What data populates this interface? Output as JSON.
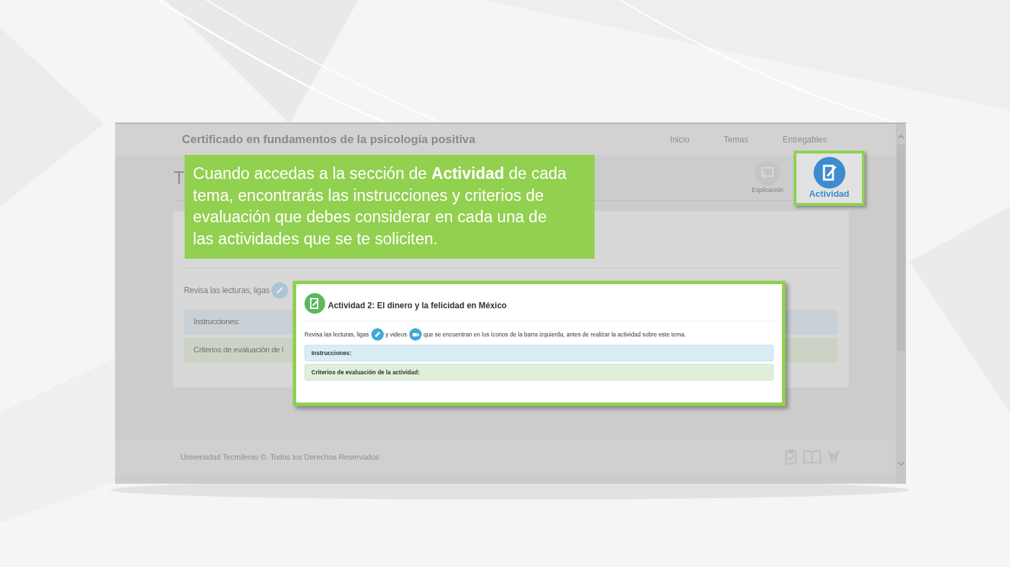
{
  "site": {
    "title": "Certificado en fundamentos de la psicología positiva",
    "nav": [
      {
        "label": "Inicio"
      },
      {
        "label": "Temas"
      },
      {
        "label": "Entregables"
      }
    ]
  },
  "section_title": "T",
  "tools": [
    {
      "label": "Explicación",
      "highlighted": false
    },
    {
      "label": "Actividad",
      "highlighted": true
    }
  ],
  "content": {
    "intro": "Revisa las lecturas, ligas",
    "panels": [
      {
        "kind": "info",
        "label": "Instrucciones:"
      },
      {
        "kind": "success",
        "label": "Criterios de evaluación de l"
      }
    ]
  },
  "footer": {
    "text": "Universidad Tecmilenio ©. Todos los Derechos Reservados"
  },
  "callout": {
    "text": "Cuando accedas a la sección de **Actividad** de cada tema, encontrarás las instrucciones y criterios de evaluación que debes considerar en cada una de las actividades que se te soliciten."
  },
  "zoom_card": {
    "title": "Actividad 2: El dinero y la felicidad en México",
    "intro": [
      {
        "kind": "text",
        "text": "Revisa las lecturas, ligas"
      },
      {
        "kind": "link"
      },
      {
        "kind": "text",
        "text": "y videos"
      },
      {
        "kind": "video"
      },
      {
        "kind": "text",
        "text": "que se encuentran en los íconos de la barra izquierda, antes de realizar la actividad sobre este tema."
      }
    ],
    "panels": [
      {
        "kind": "info",
        "label": "Instrucciones:"
      },
      {
        "kind": "success",
        "label": "Criterios de evaluación de la actividad:"
      }
    ]
  }
}
